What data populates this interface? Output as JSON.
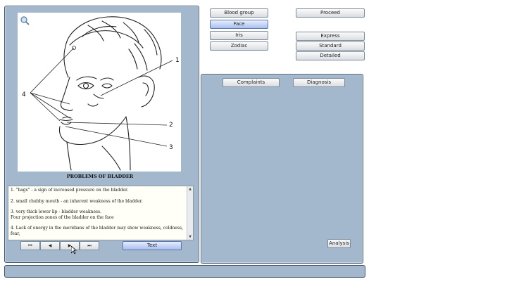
{
  "top_buttons": {
    "blood_group": "Blood group",
    "face": "Face",
    "iris": "Iris",
    "zodiac": "Zodiac",
    "proceed": "Proceed",
    "express": "Express",
    "standard": "Standard",
    "detailed": "Detailed"
  },
  "figure": {
    "caption": "PROBLEMS OF BLADDER",
    "labels": {
      "l1": "1",
      "l2": "2",
      "l3": "3",
      "l4": "4"
    }
  },
  "description": {
    "lines": [
      "1. \"bags\" - a sign of increased pressure on the bladder.",
      "2. small chubby mouth - an inherent weakness of the bladder.",
      "3. very thick lower lip - bladder weakness.",
      "Four projection zones of the bladder on the face",
      "4. Lack of energy in the meridians of the bladder may show weakness, coldness, fear,"
    ]
  },
  "nav": {
    "first": "⏮",
    "prev": "◀",
    "next": "▶",
    "last": "⏭",
    "text_button": "Text"
  },
  "right_panel": {
    "complaints": "Complaints",
    "diagnosis": "Diagnosis",
    "analysis": "Analysis"
  },
  "icons": {
    "zoom": "magnifier-icon"
  }
}
